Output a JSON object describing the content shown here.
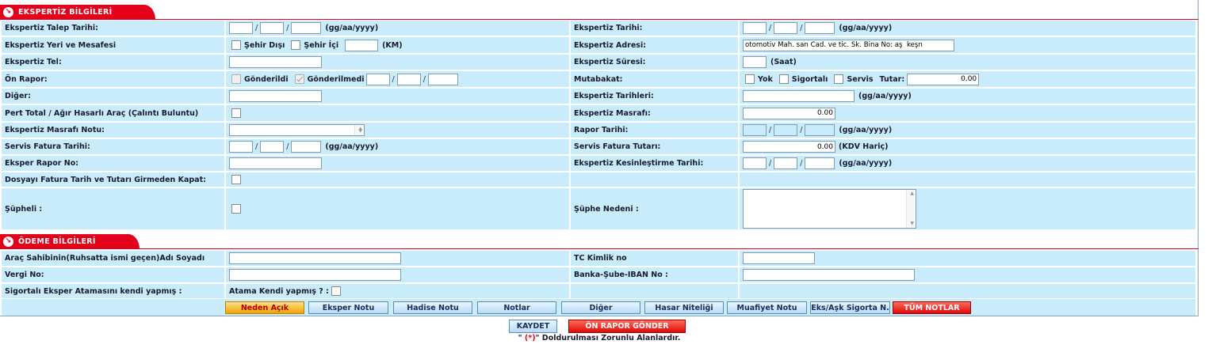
{
  "sections": {
    "ekspertiz": "EKSPERTİZ BİLGİLERİ",
    "odeme": "ÖDEME BİLGİLERİ"
  },
  "date_format": "(gg/aa/yyyy)",
  "rows": {
    "talep_tarihi": "Ekspertiz Talep Tarihi:",
    "ekspertiz_tarihi": "Ekspertiz Tarihi:",
    "yeri_mesafesi": "Ekspertiz Yeri ve Mesafesi",
    "sehir_disi": "Şehir Dışı",
    "sehir_ici": "Şehir İçi",
    "km": "(KM)",
    "adresi": "Ekspertiz Adresi:",
    "adresi_value": "otomotiv Mah. san Cad. ve tic. Sk. Bina No: aş  keşn",
    "tel": "Ekspertiz Tel:",
    "suresi": "Ekspertiz Süresi:",
    "saat": "(Saat)",
    "on_rapor": "Ön Rapor:",
    "gonderildi": "Gönderildi",
    "gonderilmedi": "Gönderilmedi",
    "mutabakat": "Mutabakat:",
    "yok": "Yok",
    "sigortali": "Sigortalı",
    "servis": "Servis",
    "tutar": "Tutar:",
    "tutar_value": "0.00",
    "diger": "Diğer:",
    "tarihleri": "Ekspertiz Tarihleri:",
    "pert_total": "Pert Total / Ağır Hasarlı Araç (Çalıntı Buluntu)",
    "masrafi": "Ekspertiz Masrafı:",
    "masrafi_value": "0.00",
    "masrafi_notu": "Ekspertiz Masrafı Notu:",
    "rapor_tarihi": "Rapor Tarihi:",
    "servis_fatura_tarihi": "Servis Fatura Tarihi:",
    "servis_fatura_tutari": "Servis Fatura Tutarı:",
    "servis_fatura_tutari_value": "0.00",
    "kdv_haric": "(KDV Hariç)",
    "eksper_rapor_no": "Eksper Rapor No:",
    "kesinlestirme_tarihi": "Ekspertiz Kesinleştirme Tarihi:",
    "dosya_kapat": "Dosyayı Fatura Tarih ve Tutarı Girmeden Kapat:",
    "supheli": "Şüpheli :",
    "suphe_nedeni": "Şüphe Nedeni :"
  },
  "odeme": {
    "arac_sahibi": "Araç Sahibinin(Ruhsatta ismi geçen)Adı Soyadı",
    "tc_kimlik": "TC Kimlik no",
    "vergi_no": "Vergi No:",
    "iban": "Banka-Şube-IBAN No :",
    "sigortali_atama": "Sigortalı Eksper Atamasını kendi yapmış :",
    "atama_kendi": "Atama Kendi yapmış ? :"
  },
  "note_buttons": [
    "Neden Açık",
    "Eksper Notu",
    "Hadise Notu",
    "Notlar",
    "Diğer",
    "Hasar Niteliği",
    "Muafiyet Notu",
    "Eks/Aşk Sigorta N.",
    "TÜM NOTLAR"
  ],
  "actions": {
    "save": "KAYDET",
    "send_report": "ÖN RAPOR GÖNDER"
  },
  "footnote": {
    "quote_open": "\" ",
    "marker": "(*)",
    "rest": "\" Doldurulması Zorunlu Alanlardır."
  },
  "colors": {
    "section": "#e3001b",
    "row_bg": "#c9ecfb",
    "accent_orange": "#f0a400"
  }
}
